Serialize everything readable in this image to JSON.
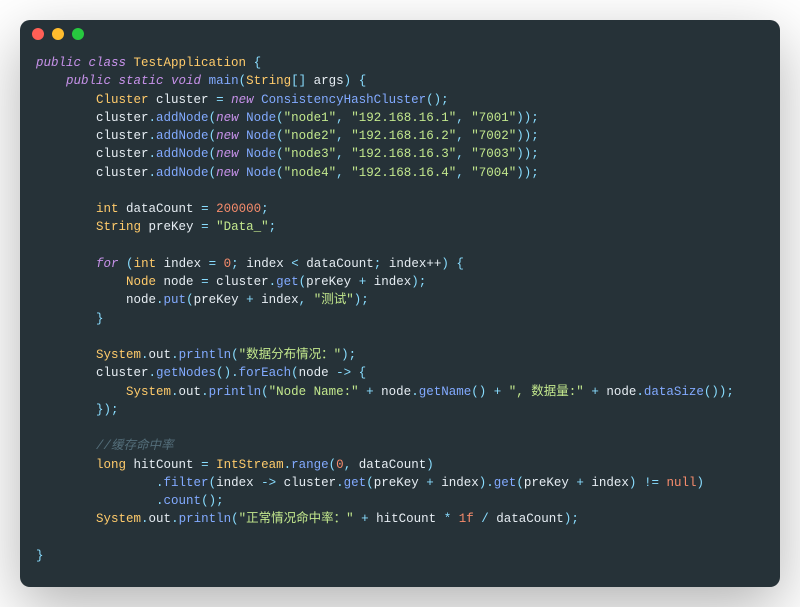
{
  "window": {
    "traffic_lights": [
      "red",
      "yellow",
      "green"
    ]
  },
  "code": {
    "class_keyword": "public class",
    "class_name": "TestApplication",
    "main_sig": {
      "public_static_void": "public static void",
      "main": "main",
      "param_type": "String",
      "param_name": "args"
    },
    "cluster_decl": {
      "type": "Cluster",
      "name": "cluster",
      "new_kw": "new",
      "ctor": "ConsistencyHashCluster"
    },
    "addNode_fn": "addNode",
    "node_ctor": "Node",
    "nodes": [
      {
        "name": "\"node1\"",
        "ip": "\"192.168.16.1\"",
        "port": "\"7001\""
      },
      {
        "name": "\"node2\"",
        "ip": "\"192.168.16.2\"",
        "port": "\"7002\""
      },
      {
        "name": "\"node3\"",
        "ip": "\"192.168.16.3\"",
        "port": "\"7003\""
      },
      {
        "name": "\"node4\"",
        "ip": "\"192.168.16.4\"",
        "port": "\"7004\""
      }
    ],
    "dataCount_decl": {
      "type": "int",
      "name": "dataCount",
      "value": "200000"
    },
    "preKey_decl": {
      "type": "String",
      "name": "preKey",
      "value": "\"Data_\""
    },
    "for_loop": {
      "for_kw": "for",
      "int_kw": "int",
      "index": "index",
      "init": "0",
      "cond_var": "dataCount",
      "inc": "index++"
    },
    "get_fn": "get",
    "put_fn": "put",
    "test_str": "\"测试\"",
    "println_fn": "println",
    "out": "out",
    "System": "System",
    "dist_str": "\"数据分布情况：\"",
    "getNodes_fn": "getNodes",
    "forEach_fn": "forEach",
    "node_param": "node",
    "nodeName_str": "\"Node Name:\"",
    "getName_fn": "getName",
    "dataSize_str": "\", 数据量:\"",
    "dataSize_fn": "dataSize",
    "cache_comment": "//缓存命中率",
    "hitCount_decl": {
      "type": "long",
      "name": "hitCount"
    },
    "IntStream": "IntStream",
    "range_fn": "range",
    "range_start": "0",
    "filter_fn": "filter",
    "null_kw": "null",
    "count_fn": "count",
    "hitRate_str": "\"正常情况命中率：\"",
    "one_f": "1f"
  }
}
